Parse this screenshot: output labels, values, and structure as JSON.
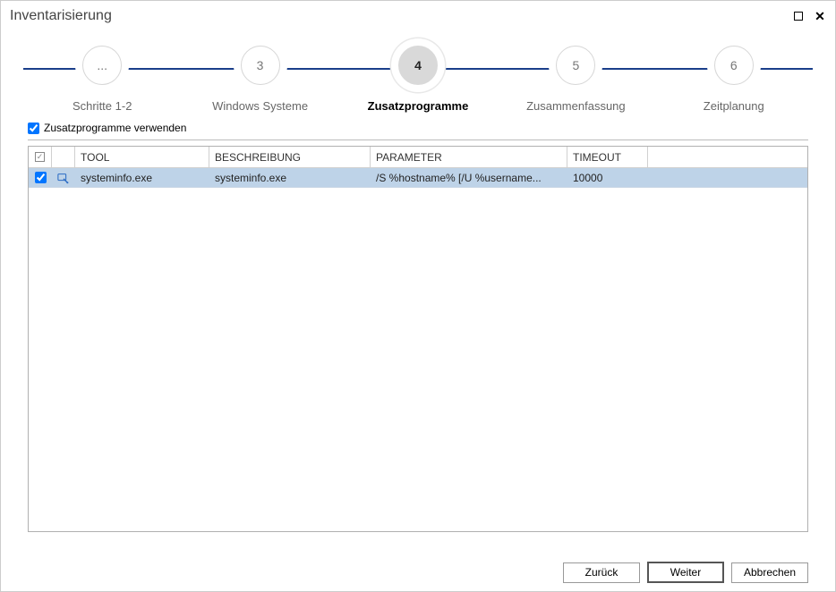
{
  "window": {
    "title": "Inventarisierung"
  },
  "stepper": {
    "steps": [
      {
        "num": "...",
        "label": "Schritte 1-2",
        "active": false
      },
      {
        "num": "3",
        "label": "Windows Systeme",
        "active": false
      },
      {
        "num": "4",
        "label": "Zusatzprogramme",
        "active": true
      },
      {
        "num": "5",
        "label": "Zusammenfassung",
        "active": false
      },
      {
        "num": "6",
        "label": "Zeitplanung",
        "active": false
      }
    ]
  },
  "use_extra_programs_label": "Zusatzprogramme verwenden",
  "use_extra_programs_checked": true,
  "grid": {
    "headers": {
      "tool": "TOOL",
      "description": "BESCHREIBUNG",
      "parameter": "PARAMETER",
      "timeout": "TIMEOUT"
    },
    "rows": [
      {
        "checked": true,
        "tool": "systeminfo.exe",
        "description": "systeminfo.exe",
        "parameter": "/S %hostname% [/U %username...",
        "timeout": "10000"
      }
    ]
  },
  "buttons": {
    "back": "Zurück",
    "next": "Weiter",
    "cancel": "Abbrechen"
  }
}
